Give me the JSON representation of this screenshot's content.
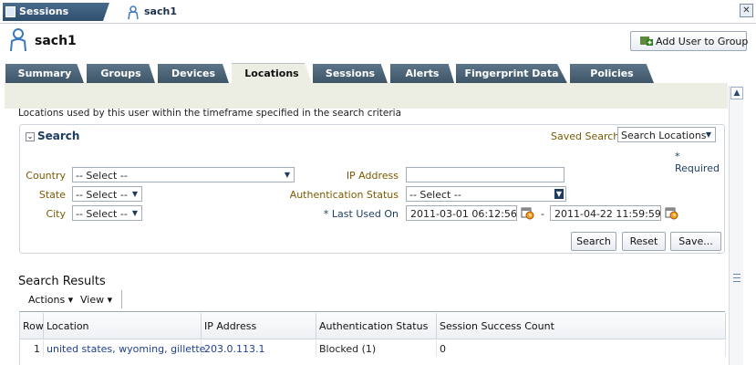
{
  "doc_tabs": {
    "active_label": "Sessions",
    "second_label": "sach1"
  },
  "header": {
    "user_name": "sach1",
    "add_user_button": "Add User to Group"
  },
  "tabs": [
    "Summary",
    "Groups",
    "Devices",
    "Locations",
    "Sessions",
    "Alerts",
    "Fingerprint Data",
    "Policies"
  ],
  "active_tab": "Locations",
  "description": "Locations used by this user within the timeframe specified in the search criteria",
  "search": {
    "title": "Search",
    "saved_search_label": "Saved Search",
    "saved_search_value": "Search Locations",
    "required_note": "* Required",
    "country_label": "Country",
    "country_value": "-- Select --",
    "state_label": "State",
    "state_value": "-- Select --",
    "city_label": "City",
    "city_value": "-- Select --",
    "ip_label": "IP Address",
    "ip_value": "",
    "auth_label": "Authentication Status",
    "auth_value": "-- Select --",
    "last_used_label": "* Last Used On",
    "date_from": "2011-03-01 06:12:56 PM",
    "date_sep": "-",
    "date_to": "2011-04-22 11:59:59 PM",
    "buttons": {
      "search": "Search",
      "reset": "Reset",
      "save": "Save..."
    }
  },
  "results": {
    "title": "Search Results",
    "actions_label": "Actions ▾",
    "view_label": "View ▾",
    "columns": [
      "Row",
      "Location",
      "IP Address",
      "Authentication Status",
      "Session Success Count"
    ],
    "rows": [
      {
        "row": "1",
        "location": "united states, wyoming, gillette",
        "ip": "203.0.113.1",
        "auth": "Blocked (1)",
        "count": "0"
      }
    ]
  },
  "colors": {
    "tab_bg": "#4e6679",
    "accent_navy": "#1d3b5e",
    "label_gold": "#7a5a00",
    "link": "#1f3f93"
  }
}
